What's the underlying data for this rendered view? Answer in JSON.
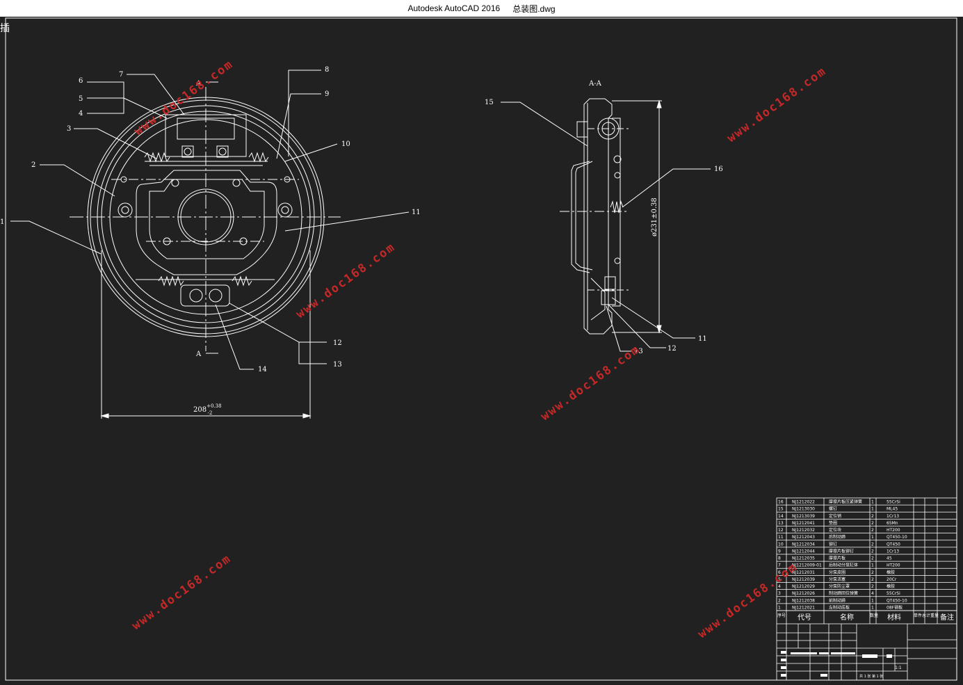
{
  "window": {
    "app_title": "Autodesk AutoCAD 2016",
    "file_name": "总装图.dwg",
    "corner_glyph": "插"
  },
  "watermark": "www.doc168.com",
  "colors": {
    "background": "#212121",
    "line": "#ffffff",
    "watermark": "#c62828",
    "titlebar": "#ffffff"
  },
  "front_view": {
    "section_mark": "A",
    "dimension": "208",
    "dimension_tol_upper": "+0.38",
    "dimension_tol_lower": "-2",
    "callouts": [
      "1",
      "2",
      "3",
      "4",
      "5",
      "6",
      "7",
      "8",
      "9",
      "10",
      "11",
      "12",
      "13",
      "14"
    ]
  },
  "section_view": {
    "title": "A-A",
    "dimension": "ø231±0.38",
    "callouts": [
      "15",
      "16",
      "11",
      "12",
      "13"
    ]
  },
  "parts_list": {
    "rows": [
      {
        "no": "16",
        "code": "NJ1212022",
        "name": "摩擦片板压紧弹簧",
        "qty": "1",
        "material": "55CrSi"
      },
      {
        "no": "15",
        "code": "NJ1213030",
        "name": "螺钉",
        "qty": "1",
        "material": "ML45"
      },
      {
        "no": "14",
        "code": "NJ1213039",
        "name": "定位销",
        "qty": "2",
        "material": "1Cr13"
      },
      {
        "no": "13",
        "code": "NJ1212041",
        "name": "垫圈",
        "qty": "2",
        "material": "65Mn"
      },
      {
        "no": "12",
        "code": "NJ1212032",
        "name": "定位块",
        "qty": "2",
        "material": "HT200"
      },
      {
        "no": "11",
        "code": "NJ1212043",
        "name": "后制动蹄",
        "qty": "1",
        "material": "QT450-10"
      },
      {
        "no": "10",
        "code": "NJ1212034",
        "name": "铆钉",
        "qty": "2",
        "material": "QT450"
      },
      {
        "no": "9",
        "code": "NJ1212044",
        "name": "摩擦片板铆钉",
        "qty": "2",
        "material": "1Cr13"
      },
      {
        "no": "8",
        "code": "NJ1212035",
        "name": "摩擦片板",
        "qty": "2",
        "material": "45"
      },
      {
        "no": "7",
        "code": "NJ1212009-01",
        "name": "后制动分泵缸体",
        "qty": "1",
        "material": "HT200"
      },
      {
        "no": "6",
        "code": "NJ1212031",
        "name": "分泵皮圈",
        "qty": "2",
        "material": "橡胶"
      },
      {
        "no": "5",
        "code": "NJ1212039",
        "name": "分泵活塞",
        "qty": "2",
        "material": "20Cr"
      },
      {
        "no": "4",
        "code": "NJ1212029",
        "name": "分泵防尘罩",
        "qty": "2",
        "material": "橡胶"
      },
      {
        "no": "3",
        "code": "NJ1212026",
        "name": "制动蹄回位弹簧",
        "qty": "4",
        "material": "55CrSi"
      },
      {
        "no": "2",
        "code": "NJ1212038",
        "name": "前制动蹄",
        "qty": "1",
        "material": "QT450-10"
      },
      {
        "no": "1",
        "code": "NJ1212021",
        "name": "左制动底板",
        "qty": "1",
        "material": "08F钢板"
      }
    ],
    "header": {
      "no": "序号",
      "code": "代号",
      "name": "名称",
      "qty": "数量",
      "material": "材料",
      "weight": "单件总计重量",
      "remark": "备注"
    }
  },
  "title_block": {
    "scale": "1:1",
    "sheet_info": "共 1 张   第 1 张"
  }
}
